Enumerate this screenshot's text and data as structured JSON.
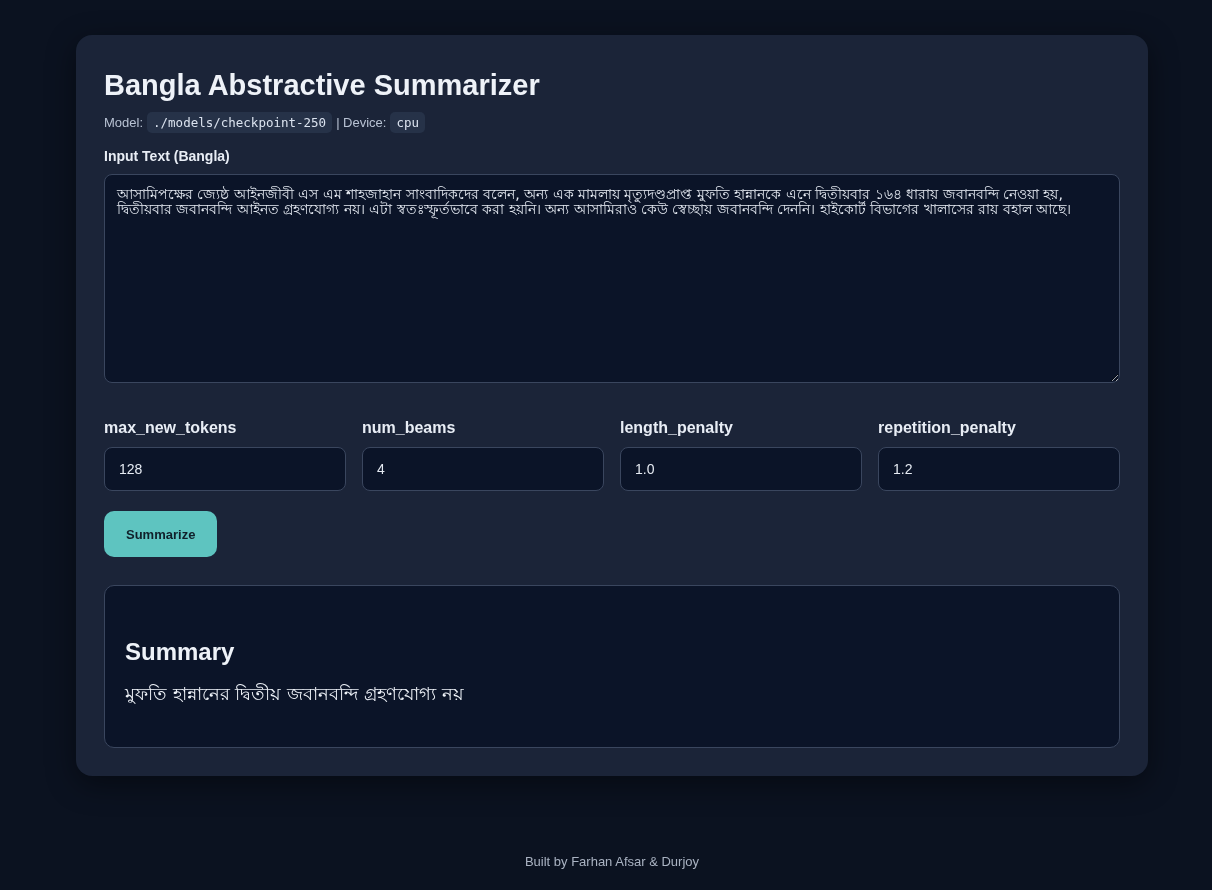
{
  "title": "Bangla Abstractive Summarizer",
  "meta": {
    "model_label": "Model:",
    "model": "./models/checkpoint-250",
    "separator": "| Device:",
    "device": "cpu"
  },
  "input": {
    "label": "Input Text (Bangla)",
    "value": "আসামিপক্ষের জ্যেষ্ঠ আইনজীবী এস এম শাহজাহান সাংবাদিকদের বলেন, অন্য এক মামলায় মৃত্যুদণ্ডপ্রাপ্ত মুফতি হান্নানকে এনে দ্বিতীয়বার ১৬৪ ধারায় জবানবন্দি নেওয়া হয়, দ্বিতীয়বার জবানবন্দি আইনত গ্রহণযোগ্য নয়। এটা স্বতঃস্ফূর্তভাবে করা হয়নি। অন্য আসামিরাও কেউ স্বেচ্ছায় জবানবন্দি দেননি। হাইকোর্ট বিভাগের খালাসের রায় বহাল আছে।"
  },
  "params": [
    {
      "label": "max_new_tokens",
      "value": "128"
    },
    {
      "label": "num_beams",
      "value": "4"
    },
    {
      "label": "length_penalty",
      "value": "1.0"
    },
    {
      "label": "repetition_penalty",
      "value": "1.2"
    }
  ],
  "button": "Summarize",
  "summary": {
    "title": "Summary",
    "text": "মুফতি হান্নানের দ্বিতীয় জবানবন্দি গ্রহণযোগ্য নয়"
  },
  "footer": "Built by Farhan Afsar & Durjoy"
}
